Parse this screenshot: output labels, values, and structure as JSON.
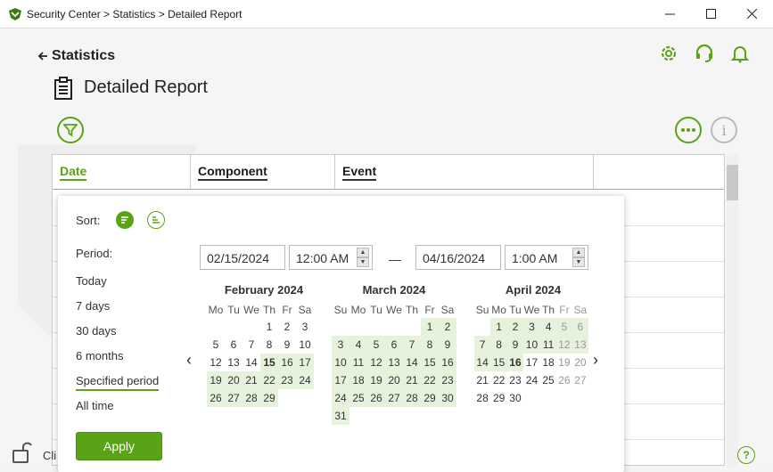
{
  "window": {
    "title": "Security Center > Statistics > Detailed Report"
  },
  "nav": {
    "back_label": "Statistics"
  },
  "header": {
    "title": "Detailed Report"
  },
  "table": {
    "columns": [
      "Date",
      "Component",
      "Event"
    ]
  },
  "popup": {
    "sort_label": "Sort:",
    "period_label": "Period:",
    "periods": [
      "Today",
      "7 days",
      "30 days",
      "6 months",
      "Specified period",
      "All time"
    ],
    "selected_period": "Specified period",
    "from_date": "02/15/2024",
    "from_time": "12:00 AM",
    "separator": "—",
    "to_date": "04/16/2024",
    "to_time": "1:00 AM",
    "apply_label": "Apply",
    "weekdays": [
      "Mo",
      "Tu",
      "We",
      "Th",
      "Fr",
      "Sa",
      "Su"
    ],
    "calendars": [
      {
        "month": "February 2024",
        "weekday_header": [
          "Mo",
          "Tu",
          "We",
          "Th",
          "Fr",
          "Sa"
        ],
        "rows": [
          [
            "",
            "",
            "",
            "1",
            "2",
            "3"
          ],
          [
            "5",
            "6",
            "7",
            "8",
            "9",
            "10"
          ],
          [
            "12",
            "13",
            "14",
            "15",
            "16",
            "17"
          ],
          [
            "19",
            "20",
            "21",
            "22",
            "23",
            "24"
          ],
          [
            "26",
            "27",
            "28",
            "29",
            "",
            ""
          ]
        ]
      },
      {
        "month": "March 2024",
        "weekday_header": [
          "Su",
          "Mo",
          "Tu",
          "We",
          "Th",
          "Fr",
          "Sa"
        ],
        "rows": [
          [
            "",
            "",
            "",
            "",
            "",
            "1",
            "2"
          ],
          [
            "3",
            "4",
            "5",
            "6",
            "7",
            "8",
            "9"
          ],
          [
            "10",
            "11",
            "12",
            "13",
            "14",
            "15",
            "16"
          ],
          [
            "17",
            "18",
            "19",
            "20",
            "21",
            "22",
            "23"
          ],
          [
            "24",
            "25",
            "26",
            "27",
            "28",
            "29",
            "30"
          ],
          [
            "31",
            "",
            "",
            "",
            "",
            "",
            ""
          ]
        ]
      },
      {
        "month": "April 2024",
        "weekday_header": [
          "Su",
          "Mo",
          "Tu",
          "We",
          "Th",
          "Fr",
          "Sa"
        ],
        "rows": [
          [
            "",
            "1",
            "2",
            "3",
            "4",
            "5",
            "6"
          ],
          [
            "7",
            "8",
            "9",
            "10",
            "11",
            "12",
            "13"
          ],
          [
            "14",
            "15",
            "16",
            "17",
            "18",
            "19",
            "20"
          ],
          [
            "21",
            "22",
            "23",
            "24",
            "25",
            "26",
            "27"
          ],
          [
            "28",
            "29",
            "30",
            "",
            "",
            "",
            ""
          ]
        ]
      }
    ]
  },
  "footer": {
    "lock_text": "Cli"
  },
  "colors": {
    "accent": "#5aa316",
    "range_bg": "#e6f2dc"
  }
}
